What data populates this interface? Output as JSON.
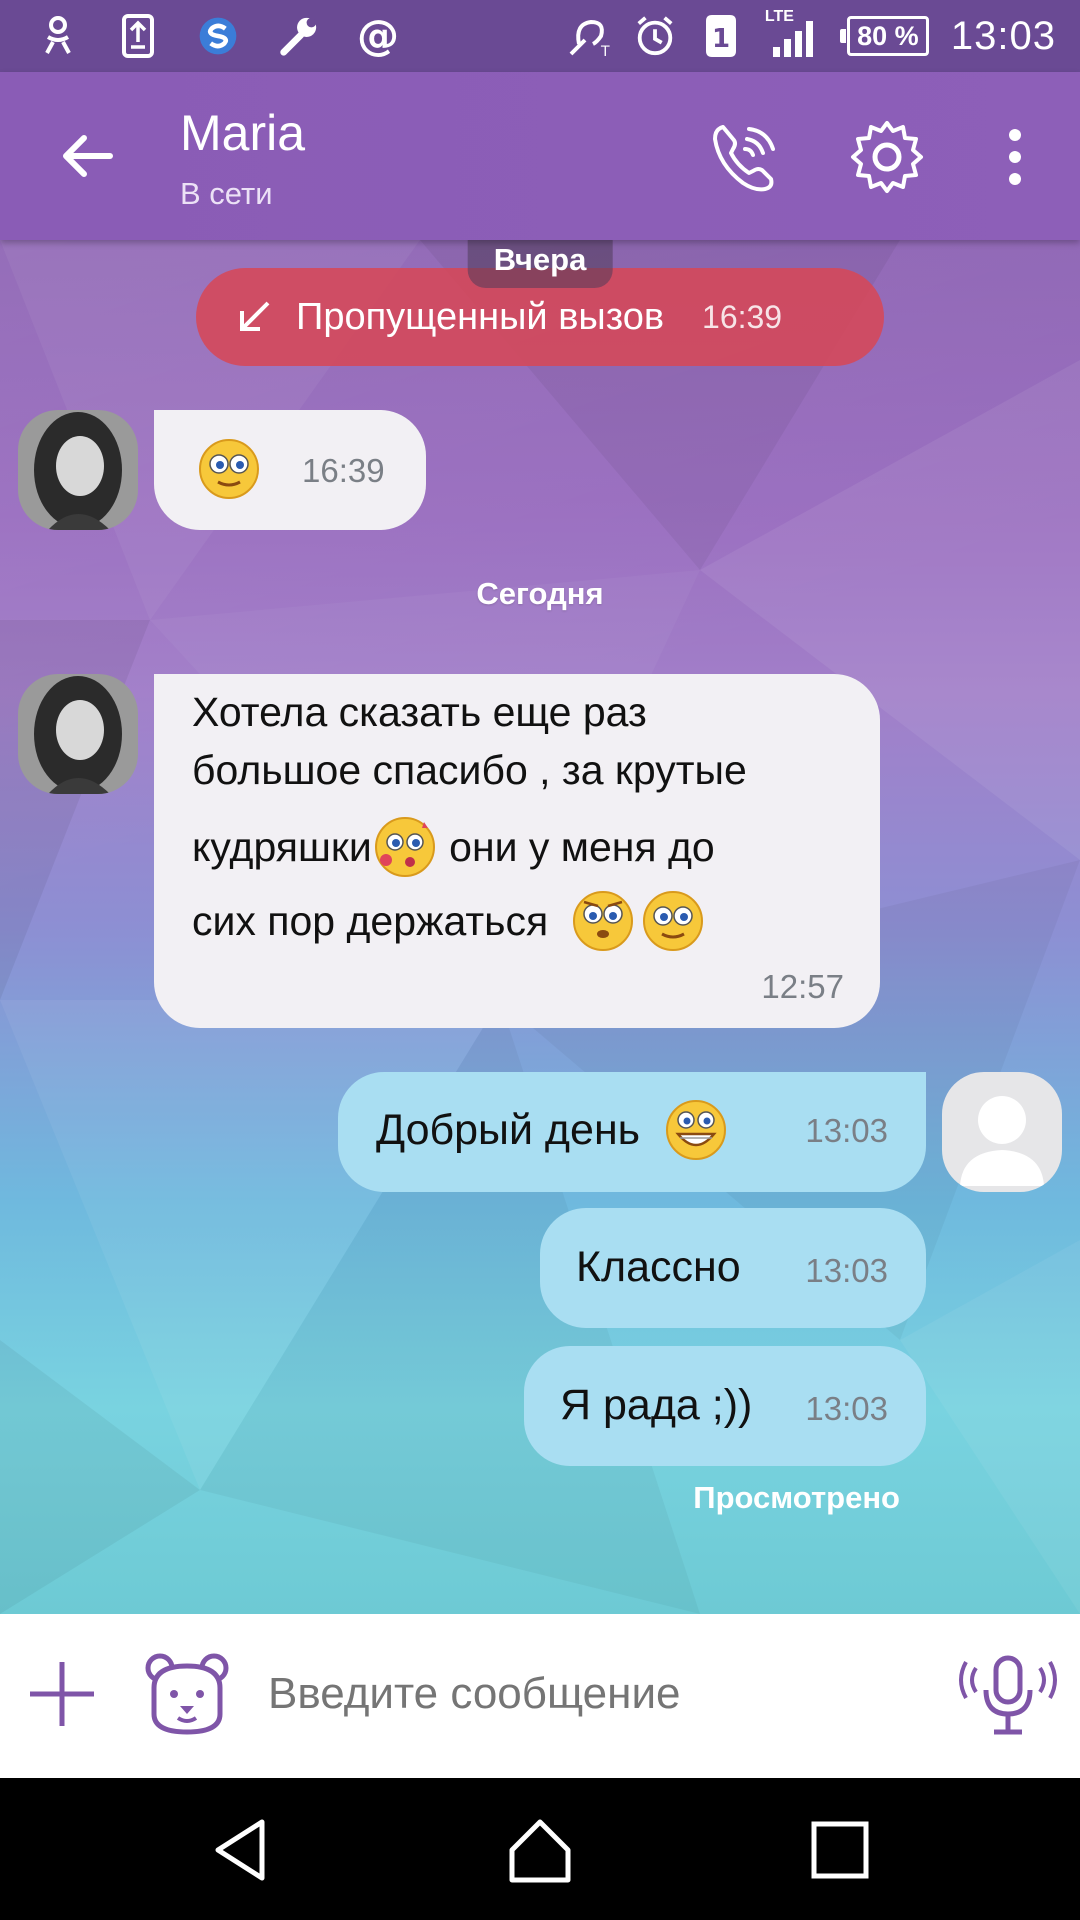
{
  "status_bar": {
    "time": "13:03",
    "battery": "80 %",
    "lte": "LTE",
    "sim": "1"
  },
  "header": {
    "contact_name": "Maria",
    "contact_status": "В сети"
  },
  "chat": {
    "date_yesterday": "Вчера",
    "missed_call": {
      "text": "Пропущенный вызов",
      "time": "16:39"
    },
    "msg1": {
      "time": "16:39"
    },
    "date_today": "Сегодня",
    "msg2": {
      "line1": "Хотела сказать еще раз",
      "line2": "большое спасибо , за крутые",
      "line3a": "кудряшки",
      "line3b": " они у меня до",
      "line4": "сих пор держаться ",
      "time": "12:57"
    },
    "msg3": {
      "text": "Добрый день ",
      "time": "13:03"
    },
    "msg4": {
      "text": "Классно",
      "time": "13:03"
    },
    "msg5": {
      "text": "Я рада ;))",
      "time": "13:03"
    },
    "seen": "Просмотрено"
  },
  "input": {
    "placeholder": "Введите сообщение"
  },
  "colors": {
    "header": "#8a5cb6",
    "statusbar": "#6a4a94",
    "incoming_bubble": "#f2f0f4",
    "outgoing_bubble": "#a9def2",
    "missed_call": "#d64858",
    "accent": "#7f55a8"
  }
}
